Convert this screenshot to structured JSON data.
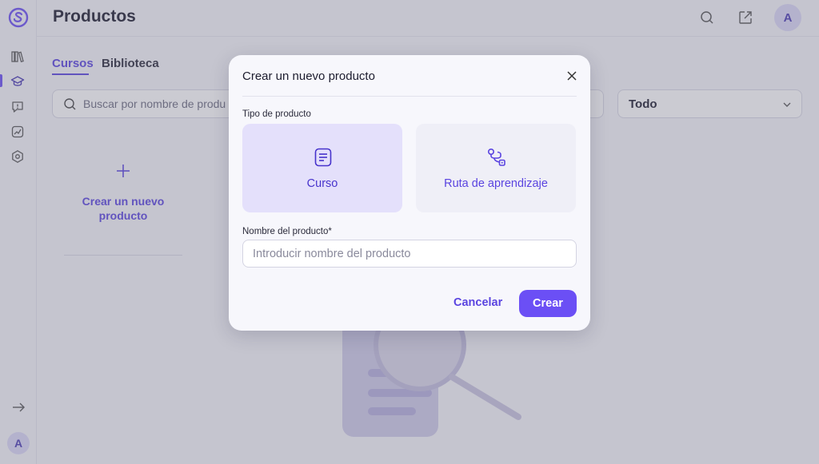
{
  "app": {
    "page_title": "Productos",
    "avatar_initial": "A"
  },
  "sidebar": {
    "items": [
      {
        "icon": "library-icon"
      },
      {
        "icon": "graduation-cap-icon",
        "active": true
      },
      {
        "icon": "chat-alert-icon"
      },
      {
        "icon": "analytics-icon"
      },
      {
        "icon": "settings-icon"
      }
    ],
    "collapse_icon": "arrow-right-icon",
    "avatar_initial": "A"
  },
  "header": {
    "icons": [
      "search-icon",
      "external-link-icon"
    ]
  },
  "tabs": [
    {
      "label": "Cursos",
      "active": true
    },
    {
      "label": "Biblioteca",
      "active": false
    }
  ],
  "search": {
    "placeholder": "Buscar por nombre de produ"
  },
  "filter": {
    "value": "Todo"
  },
  "create_card": {
    "label": "Crear un nuevo producto"
  },
  "modal": {
    "title": "Crear un nuevo producto",
    "type_label": "Tipo de producto",
    "types": [
      {
        "label": "Curso",
        "icon": "document-icon",
        "selected": true
      },
      {
        "label": "Ruta de aprendizaje",
        "icon": "route-icon",
        "selected": false
      }
    ],
    "name_label": "Nombre del producto*",
    "name_placeholder": "Introducir nombre del producto",
    "cancel_label": "Cancelar",
    "create_label": "Crear"
  },
  "colors": {
    "accent": "#6b4ff5",
    "accent_text": "#5a44e0",
    "selected_card": "#e4e0fb",
    "overlay": "rgba(110,110,130,0.36)"
  }
}
